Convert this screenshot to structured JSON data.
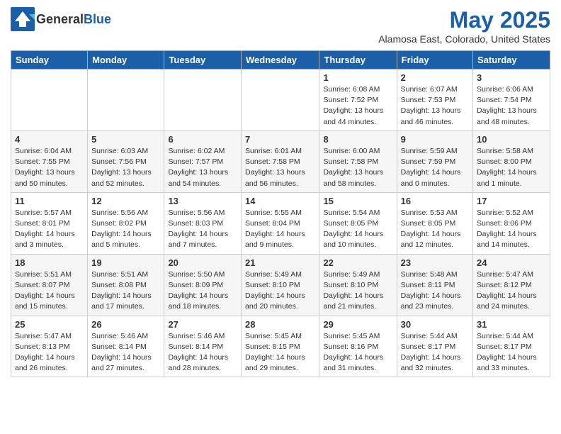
{
  "header": {
    "logo_general": "General",
    "logo_blue": "Blue",
    "month_title": "May 2025",
    "location": "Alamosa East, Colorado, United States"
  },
  "days_of_week": [
    "Sunday",
    "Monday",
    "Tuesday",
    "Wednesday",
    "Thursday",
    "Friday",
    "Saturday"
  ],
  "weeks": [
    [
      {
        "day": "",
        "info": ""
      },
      {
        "day": "",
        "info": ""
      },
      {
        "day": "",
        "info": ""
      },
      {
        "day": "",
        "info": ""
      },
      {
        "day": "1",
        "info": "Sunrise: 6:08 AM\nSunset: 7:52 PM\nDaylight: 13 hours\nand 44 minutes."
      },
      {
        "day": "2",
        "info": "Sunrise: 6:07 AM\nSunset: 7:53 PM\nDaylight: 13 hours\nand 46 minutes."
      },
      {
        "day": "3",
        "info": "Sunrise: 6:06 AM\nSunset: 7:54 PM\nDaylight: 13 hours\nand 48 minutes."
      }
    ],
    [
      {
        "day": "4",
        "info": "Sunrise: 6:04 AM\nSunset: 7:55 PM\nDaylight: 13 hours\nand 50 minutes."
      },
      {
        "day": "5",
        "info": "Sunrise: 6:03 AM\nSunset: 7:56 PM\nDaylight: 13 hours\nand 52 minutes."
      },
      {
        "day": "6",
        "info": "Sunrise: 6:02 AM\nSunset: 7:57 PM\nDaylight: 13 hours\nand 54 minutes."
      },
      {
        "day": "7",
        "info": "Sunrise: 6:01 AM\nSunset: 7:58 PM\nDaylight: 13 hours\nand 56 minutes."
      },
      {
        "day": "8",
        "info": "Sunrise: 6:00 AM\nSunset: 7:58 PM\nDaylight: 13 hours\nand 58 minutes."
      },
      {
        "day": "9",
        "info": "Sunrise: 5:59 AM\nSunset: 7:59 PM\nDaylight: 14 hours\nand 0 minutes."
      },
      {
        "day": "10",
        "info": "Sunrise: 5:58 AM\nSunset: 8:00 PM\nDaylight: 14 hours\nand 1 minute."
      }
    ],
    [
      {
        "day": "11",
        "info": "Sunrise: 5:57 AM\nSunset: 8:01 PM\nDaylight: 14 hours\nand 3 minutes."
      },
      {
        "day": "12",
        "info": "Sunrise: 5:56 AM\nSunset: 8:02 PM\nDaylight: 14 hours\nand 5 minutes."
      },
      {
        "day": "13",
        "info": "Sunrise: 5:56 AM\nSunset: 8:03 PM\nDaylight: 14 hours\nand 7 minutes."
      },
      {
        "day": "14",
        "info": "Sunrise: 5:55 AM\nSunset: 8:04 PM\nDaylight: 14 hours\nand 9 minutes."
      },
      {
        "day": "15",
        "info": "Sunrise: 5:54 AM\nSunset: 8:05 PM\nDaylight: 14 hours\nand 10 minutes."
      },
      {
        "day": "16",
        "info": "Sunrise: 5:53 AM\nSunset: 8:05 PM\nDaylight: 14 hours\nand 12 minutes."
      },
      {
        "day": "17",
        "info": "Sunrise: 5:52 AM\nSunset: 8:06 PM\nDaylight: 14 hours\nand 14 minutes."
      }
    ],
    [
      {
        "day": "18",
        "info": "Sunrise: 5:51 AM\nSunset: 8:07 PM\nDaylight: 14 hours\nand 15 minutes."
      },
      {
        "day": "19",
        "info": "Sunrise: 5:51 AM\nSunset: 8:08 PM\nDaylight: 14 hours\nand 17 minutes."
      },
      {
        "day": "20",
        "info": "Sunrise: 5:50 AM\nSunset: 8:09 PM\nDaylight: 14 hours\nand 18 minutes."
      },
      {
        "day": "21",
        "info": "Sunrise: 5:49 AM\nSunset: 8:10 PM\nDaylight: 14 hours\nand 20 minutes."
      },
      {
        "day": "22",
        "info": "Sunrise: 5:49 AM\nSunset: 8:10 PM\nDaylight: 14 hours\nand 21 minutes."
      },
      {
        "day": "23",
        "info": "Sunrise: 5:48 AM\nSunset: 8:11 PM\nDaylight: 14 hours\nand 23 minutes."
      },
      {
        "day": "24",
        "info": "Sunrise: 5:47 AM\nSunset: 8:12 PM\nDaylight: 14 hours\nand 24 minutes."
      }
    ],
    [
      {
        "day": "25",
        "info": "Sunrise: 5:47 AM\nSunset: 8:13 PM\nDaylight: 14 hours\nand 26 minutes."
      },
      {
        "day": "26",
        "info": "Sunrise: 5:46 AM\nSunset: 8:14 PM\nDaylight: 14 hours\nand 27 minutes."
      },
      {
        "day": "27",
        "info": "Sunrise: 5:46 AM\nSunset: 8:14 PM\nDaylight: 14 hours\nand 28 minutes."
      },
      {
        "day": "28",
        "info": "Sunrise: 5:45 AM\nSunset: 8:15 PM\nDaylight: 14 hours\nand 29 minutes."
      },
      {
        "day": "29",
        "info": "Sunrise: 5:45 AM\nSunset: 8:16 PM\nDaylight: 14 hours\nand 31 minutes."
      },
      {
        "day": "30",
        "info": "Sunrise: 5:44 AM\nSunset: 8:17 PM\nDaylight: 14 hours\nand 32 minutes."
      },
      {
        "day": "31",
        "info": "Sunrise: 5:44 AM\nSunset: 8:17 PM\nDaylight: 14 hours\nand 33 minutes."
      }
    ]
  ]
}
